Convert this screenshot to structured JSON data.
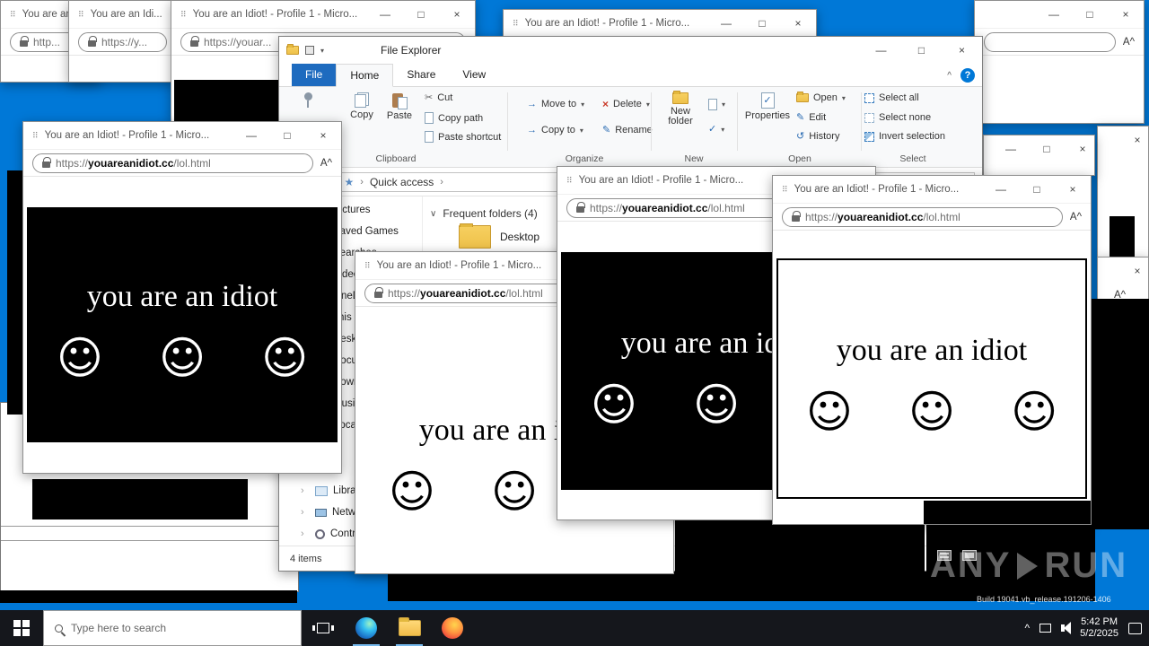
{
  "colors": {
    "desktop": "#0078d7",
    "taskbar": "#15171c",
    "file_tab_blue": "#1e6bbf",
    "ribbon_blue": "#2b6cb3",
    "delete_red": "#ca3b2a"
  },
  "icons": {
    "page": "⠿",
    "minimize": "—",
    "maximize": "□",
    "close": "×",
    "smiley": "☺",
    "read_aloud": "A^",
    "chevron_down": "▾",
    "chevron_right": "›",
    "section_collapse": "∨",
    "up_arrow": "↑",
    "back_arrow": "←",
    "forward_arrow": "→",
    "ribbon_collapse": "^",
    "help": "?",
    "tray_up": "^",
    "star": "★",
    "check": "✓",
    "cut": "✂",
    "pencil": "✎",
    "history": "↺",
    "delete_x": "×",
    "move_arrow": "→"
  },
  "url": {
    "scheme": "https://",
    "host": "youareanidiot.cc",
    "path": "/lol.html"
  },
  "page": {
    "text": "you are an idiot"
  },
  "windows": {
    "pw1": {
      "title": "You are an...",
      "url_text": "http..."
    },
    "pw2": {
      "title": "You are an Idi...",
      "url_text": "https://y..."
    },
    "pw3": {
      "title": "You are an Idiot! - Profile 1 - Micro...",
      "url_text": "https://youar..."
    },
    "pw4": {
      "title": "You are an Idiot! - Profile 1 - Micro..."
    },
    "f": {
      "title": "You are an Idiot! - Profile 1 - Micro..."
    },
    "g": {
      "title": "You are an Idiot! - Profile 1 - Micro..."
    },
    "h": {
      "title": "You are an Idiot! - Profile 1 - Micro..."
    },
    "i": {
      "title": "You are an Idiot! - Profile 1 - Micro..."
    }
  },
  "explorer": {
    "title": "File Explorer",
    "tabs": {
      "file": "File",
      "home": "Home",
      "share": "Share",
      "view": "View"
    },
    "ribbon": {
      "copy": "Copy",
      "paste": "Paste",
      "cut": "Cut",
      "copy_path": "Copy path",
      "paste_shortcut": "Paste shortcut",
      "move_to": "Move to",
      "copy_to": "Copy to",
      "delete": "Delete",
      "rename": "Rename",
      "new_folder": "New folder",
      "properties": "Properties",
      "open": "Open",
      "edit": "Edit",
      "history": "History",
      "select_all": "Select all",
      "select_none": "Select none",
      "invert_selection": "Invert selection",
      "groups": {
        "clipboard": "Clipboard",
        "organize": "Organize",
        "new": "New",
        "open": "Open",
        "select": "Select"
      }
    },
    "breadcrumb": {
      "root": "Quick access"
    },
    "frequent_header": "Frequent folders (4)",
    "tiles": {
      "desktop": "Desktop"
    },
    "status": "4 items",
    "sidebar": [
      "Pictures",
      "Saved Games",
      "Searches",
      "Videos",
      "OneDrive",
      "This PC",
      "Desktop",
      "Documents",
      "Downloads",
      "Music",
      "Local Disk (C:)",
      "Libraries",
      "Network",
      "Control Panel"
    ]
  },
  "taskbar": {
    "search_placeholder": "Type here to search",
    "time": "5:42 PM",
    "date": "5/2/2025"
  },
  "watermark": {
    "brand_left": "ANY",
    "brand_right": "RUN",
    "build": "Build 19041.vb_release.191206-1406"
  }
}
